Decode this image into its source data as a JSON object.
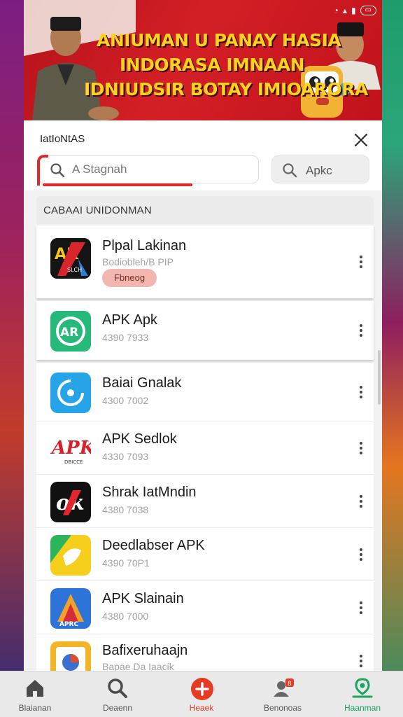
{
  "banner": {
    "headline_lines": [
      "ANIUMAN U PANAY HASIA",
      "INDORASA IMNAAN",
      "IDNIUDSIR BOTAY IMIOARORA"
    ]
  },
  "search_sheet": {
    "title": "IatIoNtAS",
    "search_placeholder": "A Stagnah",
    "apk_chip_label": "Apkc"
  },
  "list": {
    "section_title": "CABAAI UNIDONMAN",
    "featured": {
      "name": "Plpal Lakinan",
      "subtitle": "Bodiobleh/B PIP",
      "badge": "Fbneog"
    },
    "apps": [
      {
        "name": "APK Apk",
        "version": "4390 7933"
      },
      {
        "name": "Baiai Gnalak",
        "version": "4300 7002"
      },
      {
        "name": "APK Sedlok",
        "version": "4330 7093"
      },
      {
        "name": "Shrak IatMndin",
        "version": "4380 7038"
      },
      {
        "name": "Deedlabser APK",
        "version": "4390 70P1"
      },
      {
        "name": "APK Slainain",
        "version": "4380 7000"
      },
      {
        "name": "Bafixeruhaajn",
        "version": "Bapae Da Iaacik"
      }
    ]
  },
  "bottom_nav": {
    "items": [
      {
        "label": "Blaianan"
      },
      {
        "label": "Deaenn"
      },
      {
        "label": "Heaek"
      },
      {
        "label": "Benonoas"
      },
      {
        "label": "Haanman"
      }
    ]
  },
  "colors": {
    "accent_red": "#e2282b",
    "active_green": "#1aa35d"
  }
}
